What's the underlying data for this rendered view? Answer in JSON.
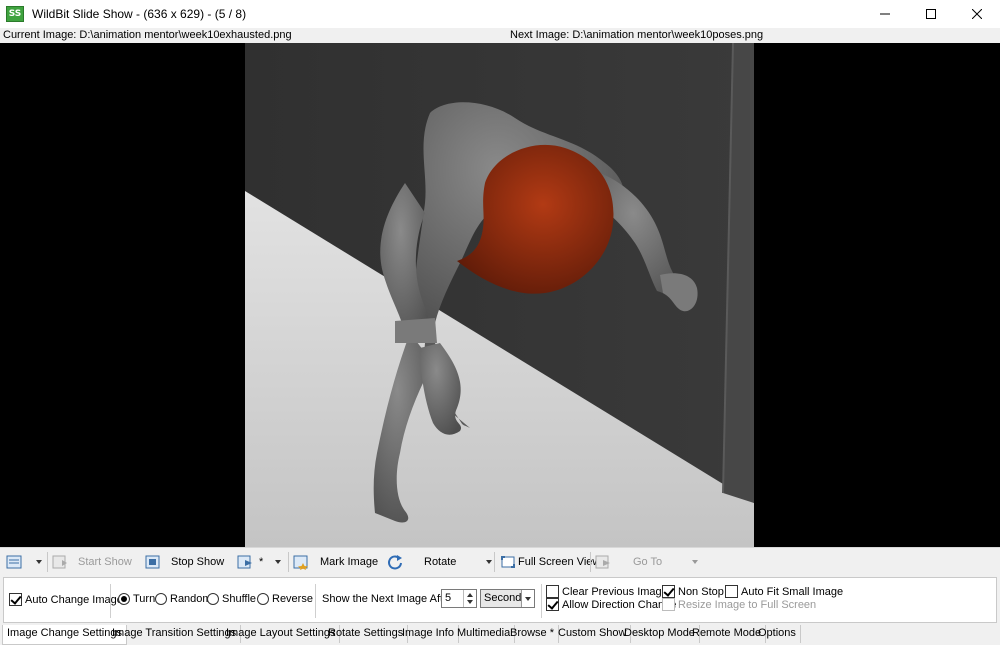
{
  "window": {
    "app_icon_text": "SS",
    "title": "WildBit Slide Show - (636 x 629) - (5 / 8)",
    "minimize_icon": "minimize-icon",
    "maximize_icon": "maximize-icon",
    "close_icon": "close-icon"
  },
  "info": {
    "current_image": "Current Image: D:\\animation mentor\\week10exhausted.png",
    "next_image": "Next Image: D:\\animation mentor\\week10poses.png"
  },
  "toolbar": {
    "start_show": "Start Show",
    "stop_show": "Stop Show",
    "star": "*",
    "mark_image": "Mark Image",
    "rotate": "Rotate",
    "full_screen_view": "Full Screen View",
    "go_to": "Go To"
  },
  "settings": {
    "auto_change_image": "Auto Change Image",
    "turn": "Turn",
    "random": "Random",
    "shuffle": "Shuffle",
    "reverse": "Reverse",
    "show_next_after": "Show the Next Image After",
    "interval_value": "5",
    "interval_unit": "Seconds",
    "clear_previous_image": "Clear Previous Image",
    "allow_direction_change": "Allow Direction Change",
    "non_stop": "Non Stop",
    "auto_fit_small_image": "Auto Fit Small Image",
    "resize_image_to_full_screen": "Resize Image to Full Screen"
  },
  "tabs": [
    "Image Change Settings",
    "Image Transition Settings",
    "Image Layout Settings",
    "Rotate Settings",
    "Image Info",
    "Multimedia",
    "Browse *",
    "Custom Show",
    "Desktop Mode",
    "Remote Mode",
    "Options"
  ],
  "colors": {
    "accent_green": "#3fa33f",
    "character_gray": "#6b6b6b",
    "balloon_red": "#8a2a10",
    "wall_dark": "#2f2f2f",
    "floor_light": "#cfcfcf"
  }
}
